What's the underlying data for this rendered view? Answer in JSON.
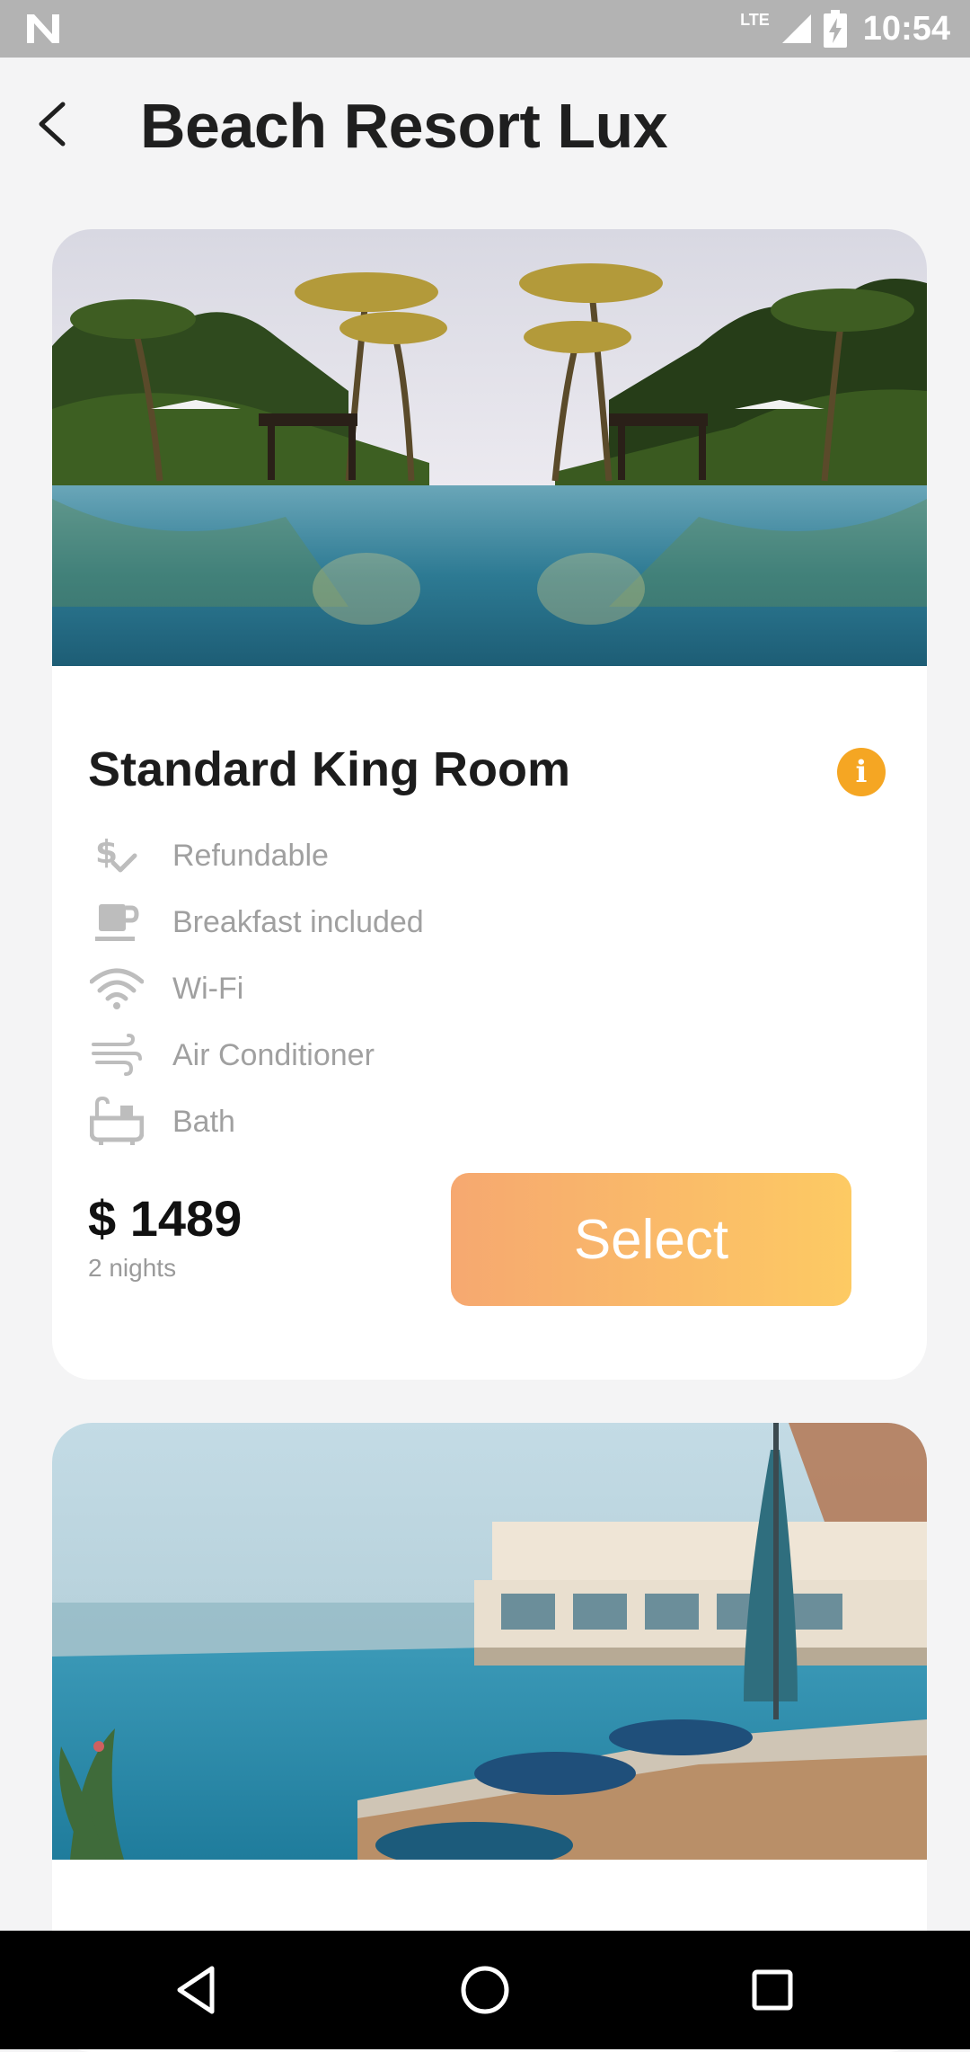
{
  "status_bar": {
    "network": "LTE",
    "time": "10:54"
  },
  "header": {
    "title": "Beach Resort Lux",
    "back_icon": "arrow-back-icon"
  },
  "rooms": [
    {
      "name": "Standard King Room",
      "info_icon": "info-icon",
      "amenities": [
        {
          "label": "Refundable",
          "icon": "refund-icon"
        },
        {
          "label": "Breakfast included",
          "icon": "coffee-cup-icon"
        },
        {
          "label": "Wi-Fi",
          "icon": "wifi-icon"
        },
        {
          "label": "Air Conditioner",
          "icon": "wind-icon"
        },
        {
          "label": "Bath",
          "icon": "bathtub-icon"
        }
      ],
      "price": "$ 1489",
      "nights": "2 nights",
      "select_label": "Select"
    }
  ],
  "colors": {
    "accent_start": "#f6a870",
    "accent_end": "#fdca63",
    "info": "#f5a623"
  },
  "nav_bar": {
    "icons": [
      "back-triangle-icon",
      "home-circle-icon",
      "recents-square-icon"
    ]
  }
}
